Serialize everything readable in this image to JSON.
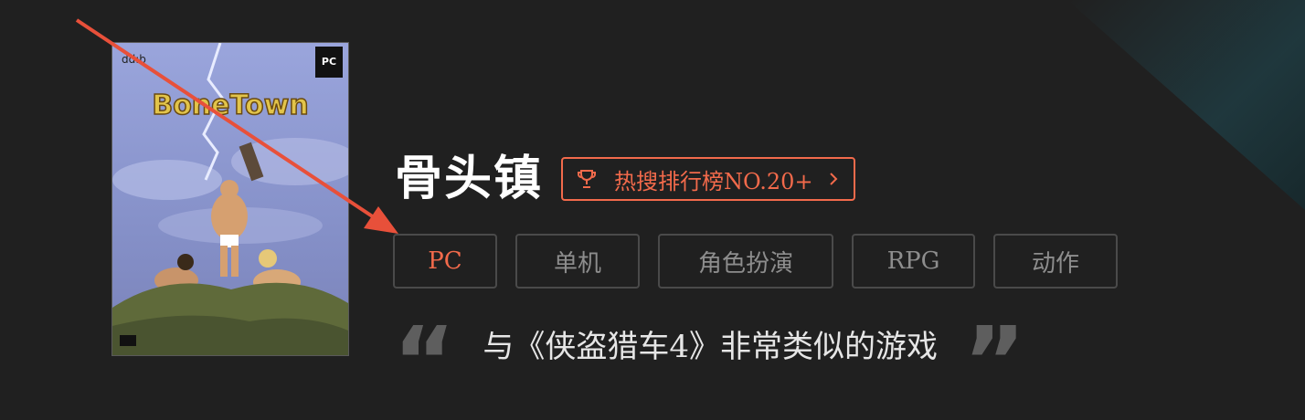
{
  "game": {
    "title": "骨头镇",
    "cover_logo_text": "BoneTown",
    "cover_platform_text": "PC"
  },
  "rank_badge": {
    "text": "热搜排行榜NO.20+",
    "icon": "trophy-icon",
    "arrow_icon": "chevron-right-icon",
    "color": "#f26a4b"
  },
  "tags": [
    {
      "label": "PC",
      "active": true
    },
    {
      "label": "单机",
      "active": false
    },
    {
      "label": "角色扮演",
      "active": false
    },
    {
      "label": "RPG",
      "active": false
    },
    {
      "label": "动作",
      "active": false
    }
  ],
  "quote": {
    "open_mark": "“",
    "text": "与《侠盗猎车4》非常类似的游戏",
    "close_mark": "”"
  },
  "colors": {
    "background": "#202020",
    "accent": "#f26a4b",
    "tag_border": "#4a4a4a",
    "tag_text": "#8d8d8d",
    "quote_mark": "#5e5e5e",
    "annotation_arrow": "#e8503a"
  }
}
